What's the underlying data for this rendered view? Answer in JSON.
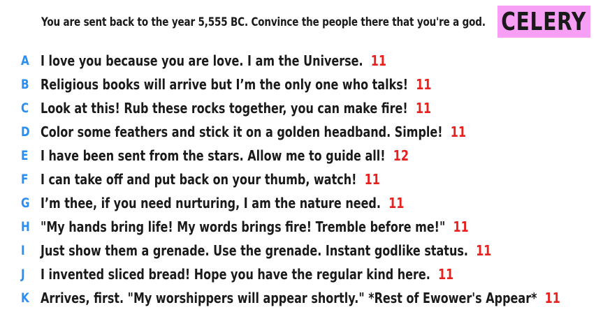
{
  "prompt": "You are sent back to the year 5,555 BC. Convince the people there that you're a god.",
  "player": {
    "name": "CELERY",
    "badge_color": "#f79ef5"
  },
  "colors": {
    "letter": "#2a8ff0",
    "score": "#e8201e",
    "text": "#1a1a1a",
    "background": "#ffffff"
  },
  "answers": [
    {
      "letter": "A",
      "text": "I love you because you are love. I am the Universe.",
      "score": "11"
    },
    {
      "letter": "B",
      "text": "Religious books will arrive but I’m the only one who talks!",
      "score": "11"
    },
    {
      "letter": "C",
      "text": "Look at this! Rub these rocks together, you can make fire!",
      "score": "11"
    },
    {
      "letter": "D",
      "text": "Color some feathers and stick it on a golden headband. Simple!",
      "score": "11"
    },
    {
      "letter": "E",
      "text": "I have been sent from the stars. Allow me to guide all!",
      "score": "12"
    },
    {
      "letter": "F",
      "text": "I can take off and put back on your thumb, watch!",
      "score": "11"
    },
    {
      "letter": "G",
      "text": "I’m thee, if you need nurturing, I am the nature need.",
      "score": "11"
    },
    {
      "letter": "H",
      "text": "\"My hands bring life! My words brings fire! Tremble before me!\"",
      "score": "11"
    },
    {
      "letter": "I",
      "text": "Just show them a grenade. Use the grenade. Instant godlike status.",
      "score": "11"
    },
    {
      "letter": "J",
      "text": "I invented sliced bread! Hope you have the regular kind here.",
      "score": "11"
    },
    {
      "letter": "K",
      "text": "Arrives, first. \"My worshippers will appear shortly.\" *Rest of Ewower's Appear*",
      "score": "11"
    }
  ]
}
